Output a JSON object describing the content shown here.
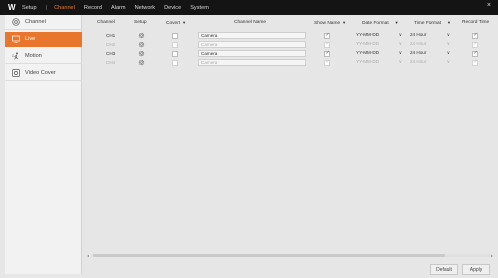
{
  "topbar": {
    "logo": "W",
    "title": "Setup",
    "separator": "|",
    "menu": [
      "Channel",
      "Record",
      "Alarm",
      "Network",
      "Device",
      "System"
    ],
    "active_menu": "Channel",
    "close_glyph": "×",
    "accent_color": "#e8762c"
  },
  "sidebar": {
    "items": [
      {
        "label": "Channel",
        "icon": "channel-icon",
        "active": false
      },
      {
        "label": "Live",
        "icon": "live-icon",
        "active": true
      },
      {
        "label": "Motion",
        "icon": "motion-icon",
        "active": false
      },
      {
        "label": "Video Cover",
        "icon": "video-cover-icon",
        "active": false
      }
    ]
  },
  "table": {
    "headers": {
      "channel": "Channel",
      "setup": "Setup",
      "covert": "Covert",
      "channel_name": "Channel Name",
      "show_name": "Show Name",
      "date_format": "Date Format",
      "time_format": "Time Format",
      "record_time": "Record Time"
    },
    "rows": [
      {
        "channel": "CH1",
        "name": "Camera",
        "covert": false,
        "show_name": true,
        "date_format": "YY-MM-DD",
        "time_format": "24 Hour",
        "record_time": true,
        "enabled": true
      },
      {
        "channel": "CH2",
        "name": "Camera",
        "covert": false,
        "show_name": true,
        "date_format": "YY-MM-DD",
        "time_format": "24 Hour",
        "record_time": true,
        "enabled": false
      },
      {
        "channel": "CH3",
        "name": "Camera",
        "covert": false,
        "show_name": true,
        "date_format": "YY-MM-DD",
        "time_format": "24 Hour",
        "record_time": true,
        "enabled": true
      },
      {
        "channel": "CH4",
        "name": "Camera",
        "covert": false,
        "show_name": true,
        "date_format": "YY-MM-DD",
        "time_format": "24 Hour",
        "record_time": true,
        "enabled": false
      }
    ]
  },
  "buttons": {
    "default": "Default",
    "apply": "Apply"
  }
}
